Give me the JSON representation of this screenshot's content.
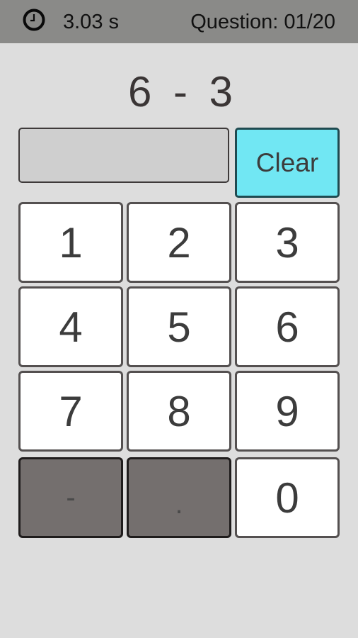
{
  "header": {
    "timer_icon": "clock-icon",
    "timer": "3.03 s",
    "question": "Question: 01/20"
  },
  "problem": "6 - 3",
  "answer": {
    "value": ""
  },
  "clear_label": "Clear",
  "keypad": {
    "keys": [
      "1",
      "2",
      "3",
      "4",
      "5",
      "6",
      "7",
      "8",
      "9",
      "-",
      ".",
      "0"
    ]
  },
  "colors": {
    "header_bg": "#8a8a88",
    "clear_bg": "#71e7f3",
    "disabled_key_bg": "#746f6e"
  }
}
